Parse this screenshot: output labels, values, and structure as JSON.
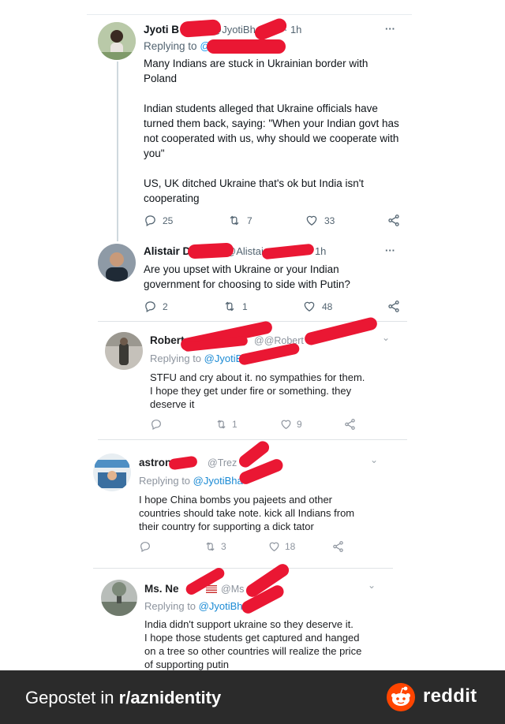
{
  "tweets": [
    {
      "name": "Jyoti B",
      "handle": "@JyotiBha",
      "time": "· 1h",
      "more": "···",
      "replying_prefix": "Replying to",
      "replying_handle": "@",
      "text": "Many Indians are stuck in Ukrainian border with Poland\n\nIndian students alleged that Ukraine officials have turned them back, saying: \"When your Indian govt has not cooperated with us, why should we cooperate with you\"\n\nUS, UK ditched Ukraine that's ok but India isn't cooperating",
      "replies": "25",
      "retweets": "7",
      "likes": "33"
    },
    {
      "name": "Alistair D",
      "handle": "@Alistai",
      "time": "· 1h",
      "more": "···",
      "text": "Are you upset with Ukraine or your Indian government for choosing to side with Putin?",
      "replies": "2",
      "retweets": "1",
      "likes": "48"
    }
  ],
  "comments": [
    {
      "name": "Robert",
      "handle": "@@Robert",
      "replying_prefix": "Replying to",
      "replying_handle": "@JyotiBha",
      "text": "STFU and cry about it. no sympathies for them.\nI hope they get under fire or something. they\ndeserve it",
      "retweets": "1",
      "likes": "9"
    },
    {
      "name": "astron",
      "handle": "@Trez",
      "replying_prefix": "Replying to",
      "replying_handle": "@JyotiBha",
      "text": "I hope China bombs you pajeets and other\ncountries should take note. kick all Indians from\ntheir country for supporting a dick tator",
      "retweets": "3",
      "likes": "18"
    },
    {
      "name": "Ms. Ne",
      "handle": "@Ms",
      "replying_prefix": "Replying to",
      "replying_handle": "@JyotiBha",
      "text": "India didn't support ukraine so they deserve it.\nI hope those students get captured and hanged\non a tree so other countries will realize the price\nof supporting putin"
    }
  ],
  "footer": {
    "prefix": "Gepostet in ",
    "subreddit": "r/aznidentity",
    "brand": "reddit"
  },
  "colors": {
    "redaction": "#ea1733",
    "twitter_blue": "#1d9bf0",
    "reddit_orange": "#ff4500",
    "footer_bg": "#2b2b2b"
  }
}
